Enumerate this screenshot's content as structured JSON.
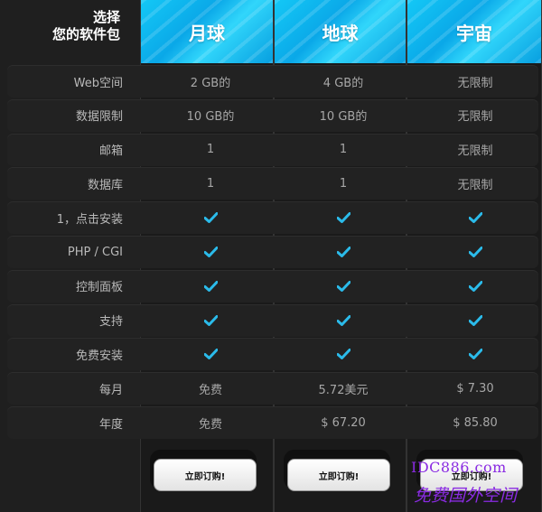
{
  "corner_title": "选择\n您的软件包",
  "plans": [
    {
      "name": "月球"
    },
    {
      "name": "地球"
    },
    {
      "name": "宇宙"
    }
  ],
  "rows": [
    {
      "label": "Web空间",
      "values": [
        "2 GB的",
        "4 GB的",
        "无限制"
      ]
    },
    {
      "label": "数据限制",
      "values": [
        "10 GB的",
        "10 GB的",
        "无限制"
      ]
    },
    {
      "label": "邮箱",
      "values": [
        "1",
        "1",
        "无限制"
      ]
    },
    {
      "label": "数据库",
      "values": [
        "1",
        "1",
        "无限制"
      ]
    },
    {
      "label": "1，点击安装",
      "values": [
        "check",
        "check",
        "check"
      ]
    },
    {
      "label": "PHP / CGI",
      "values": [
        "check",
        "check",
        "check"
      ]
    },
    {
      "label": "控制面板",
      "values": [
        "check",
        "check",
        "check"
      ]
    },
    {
      "label": "支持",
      "values": [
        "check",
        "check",
        "check"
      ]
    },
    {
      "label": "免费安装",
      "values": [
        "check",
        "check",
        "check"
      ]
    },
    {
      "label": "每月",
      "values": [
        "免费",
        "5.72美元",
        "$ 7.30"
      ]
    },
    {
      "label": "年度",
      "values": [
        "免费",
        "$ 67.20",
        "$ 85.80"
      ]
    }
  ],
  "order_button_label": "立即订购!",
  "watermark": {
    "line1": "IDC886.com",
    "line2": "免费国外空间"
  },
  "colors": {
    "header_blue": "#14c8f6",
    "check": "#2bbbea",
    "watermark": "#8a2be2"
  }
}
